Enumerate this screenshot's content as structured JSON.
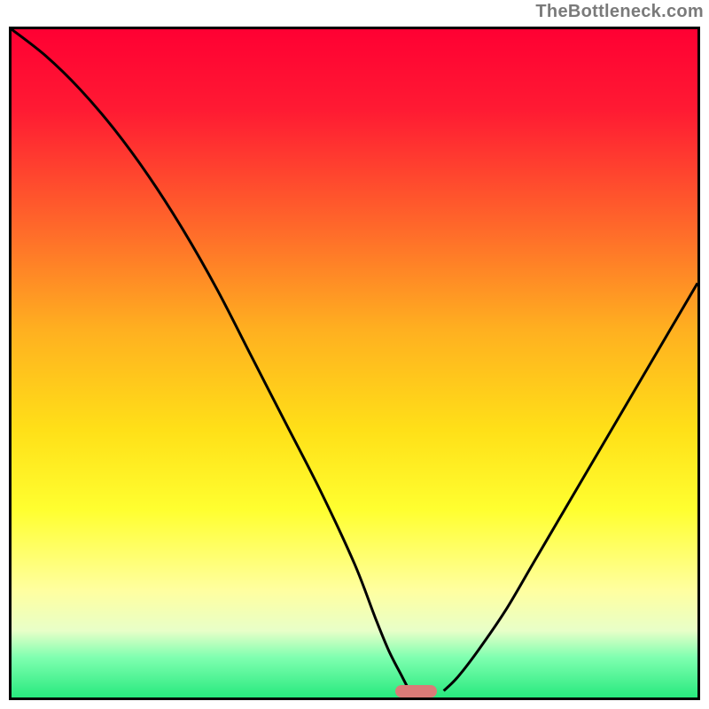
{
  "watermark": "TheBottleneck.com",
  "chart_data": {
    "type": "line",
    "title": "",
    "xlabel": "",
    "ylabel": "",
    "xlim": [
      0,
      100
    ],
    "ylim": [
      0,
      100
    ],
    "grid": false,
    "series": [
      {
        "name": "bottleneck-curve-left",
        "x": [
          0,
          5,
          10,
          15,
          20,
          25,
          30,
          35,
          40,
          45,
          50,
          53,
          55,
          57,
          58
        ],
        "values": [
          100,
          96,
          91,
          85,
          78,
          70,
          61,
          51,
          41,
          31,
          20,
          12,
          7,
          3,
          1
        ]
      },
      {
        "name": "bottleneck-curve-right",
        "x": [
          63,
          65,
          68,
          72,
          76,
          80,
          84,
          88,
          92,
          96,
          100
        ],
        "values": [
          1,
          3,
          7,
          13,
          20,
          27,
          34,
          41,
          48,
          55,
          62
        ]
      }
    ],
    "optimum_marker": {
      "x_start": 56,
      "x_end": 62,
      "y": 0
    },
    "colors": {
      "curve": "#000000",
      "marker": "#da7b78",
      "gradient_top": "#ff0033",
      "gradient_bottom": "#28e97e"
    }
  }
}
